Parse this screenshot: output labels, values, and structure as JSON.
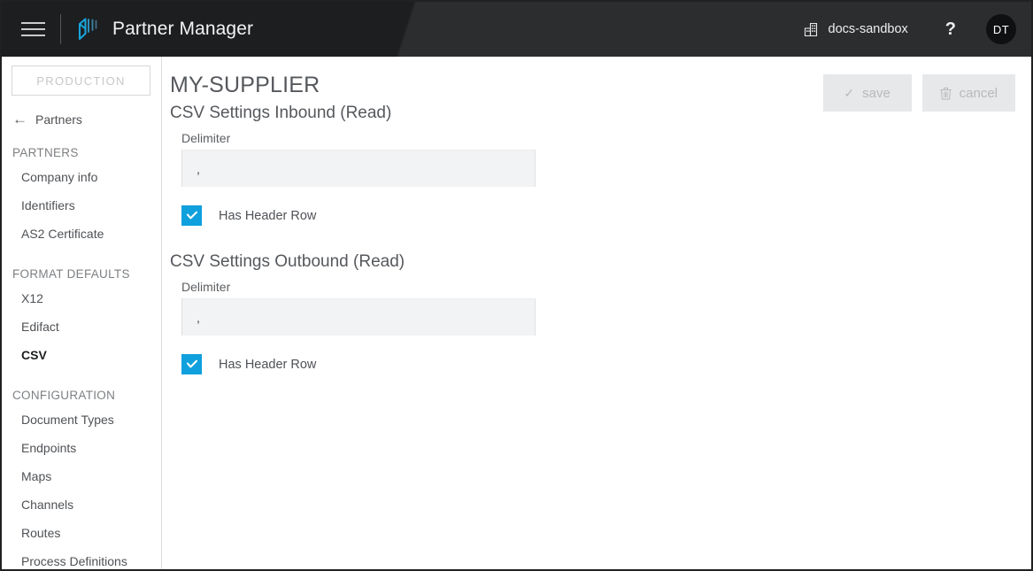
{
  "header": {
    "menu_icon": "hamburger-menu-icon",
    "logo_icon": "brand-logo-icon",
    "app_title": "Partner Manager",
    "tenant_icon": "building-icon",
    "tenant_name": "docs-sandbox",
    "help_label": "?",
    "avatar_initials": "DT"
  },
  "sidebar": {
    "environment_badge": "PRODUCTION",
    "back_arrow_icon": "arrow-left-icon",
    "back_label": "Partners",
    "groups": [
      {
        "title": "PARTNERS",
        "items": [
          {
            "label": "Company info",
            "active": false
          },
          {
            "label": "Identifiers",
            "active": false
          },
          {
            "label": "AS2 Certificate",
            "active": false
          }
        ]
      },
      {
        "title": "FORMAT DEFAULTS",
        "items": [
          {
            "label": "X12",
            "active": false
          },
          {
            "label": "Edifact",
            "active": false
          },
          {
            "label": "CSV",
            "active": true
          }
        ]
      },
      {
        "title": "CONFIGURATION",
        "items": [
          {
            "label": "Document Types",
            "active": false
          },
          {
            "label": "Endpoints",
            "active": false
          },
          {
            "label": "Maps",
            "active": false
          },
          {
            "label": "Channels",
            "active": false
          },
          {
            "label": "Routes",
            "active": false
          },
          {
            "label": "Process Definitions",
            "active": false
          }
        ]
      }
    ]
  },
  "main": {
    "page_title": "MY-SUPPLIER",
    "actions": {
      "save_label": "save",
      "save_icon": "checkmark-icon",
      "save_disabled": true,
      "cancel_label": "cancel",
      "cancel_icon": "trash-icon",
      "cancel_disabled": true
    },
    "sections": [
      {
        "title": "CSV Settings Inbound (Read)",
        "delimiter_label": "Delimiter",
        "delimiter_value": ",",
        "delimiter_placeholder": "",
        "header_row_label": "Has Header Row",
        "header_row_checked": true
      },
      {
        "title": "CSV Settings Outbound (Read)",
        "delimiter_label": "Delimiter",
        "delimiter_value": ",",
        "delimiter_placeholder": "",
        "header_row_label": "Has Header Row",
        "header_row_checked": true
      }
    ]
  },
  "colors": {
    "header_bg": "#1c1e20",
    "header_bg_light": "#2b2d2f",
    "accent_cyan": "#10a0dd",
    "text_primary": "#4f5256",
    "text_muted": "#7d8083",
    "input_bg": "#f2f3f5",
    "button_bg": "#e7e8ea",
    "button_text_disabled": "#b7b9bb"
  }
}
